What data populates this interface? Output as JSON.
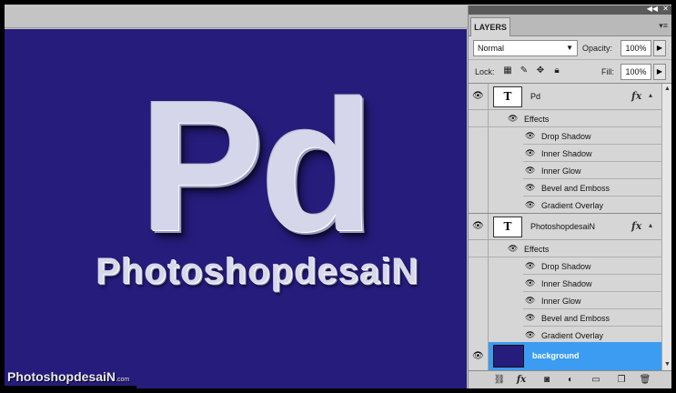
{
  "canvas": {
    "big_text": "Pd",
    "small_text": "PhotoshopdesaiN",
    "watermark": "PhotoshopdesaiN",
    "watermark_suffix": ".com",
    "background_color": "#261c7c"
  },
  "panel": {
    "tab": "LAYERS",
    "blend_mode": "Normal",
    "opacity_label": "Opacity:",
    "opacity_value": "100%",
    "lock_label": "Lock:",
    "fill_label": "Fill:",
    "fill_value": "100%",
    "layers": [
      {
        "name": "Pd",
        "type_icon": "T",
        "fx": "fx",
        "effects_label": "Effects",
        "effects": [
          "Drop Shadow",
          "Inner Shadow",
          "Inner Glow",
          "Bevel and Emboss",
          "Gradient Overlay"
        ]
      },
      {
        "name": "PhotoshopdesaiN",
        "type_icon": "T",
        "fx": "fx",
        "effects_label": "Effects",
        "effects": [
          "Drop Shadow",
          "Inner Shadow",
          "Inner Glow",
          "Bevel and Emboss",
          "Gradient Overlay"
        ]
      }
    ],
    "background_layer": {
      "name": "background",
      "selected": true
    },
    "icons": {
      "eye": "eye-icon",
      "lock_transparent": "lock-transparent-icon",
      "lock_image": "lock-image-icon",
      "lock_position": "lock-position-icon",
      "lock_all": "lock-all-icon",
      "footer": [
        "link-icon",
        "fx-icon",
        "mask-icon",
        "adjustment-icon",
        "group-icon",
        "new-layer-icon",
        "trash-icon"
      ]
    },
    "accent_color": "#3b9cf2"
  }
}
